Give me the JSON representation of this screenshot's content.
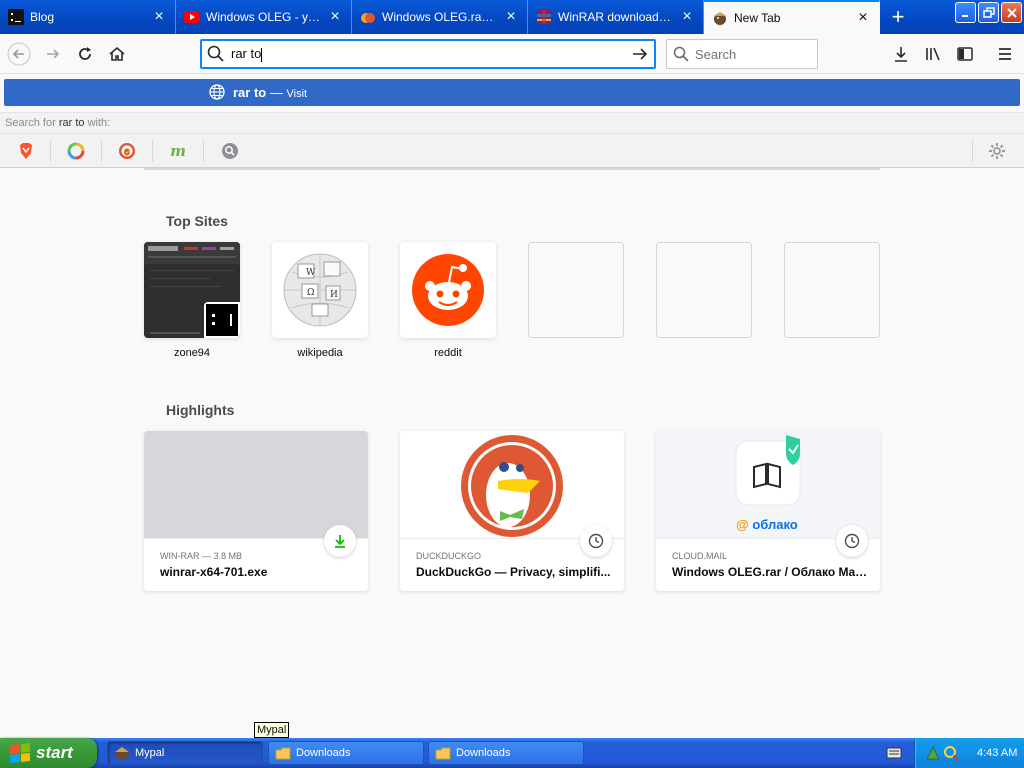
{
  "tabs": [
    {
      "title": "Blog",
      "active": false,
      "favicon": "terminal-favicon"
    },
    {
      "title": "Windows OLEG - устано...",
      "active": false,
      "favicon": "youtube-favicon"
    },
    {
      "title": "Windows OLEG.rar / Об...",
      "active": false,
      "favicon": "cloud-mail-favicon"
    },
    {
      "title": "WinRAR download free ...",
      "active": false,
      "favicon": "winrar-favicon"
    },
    {
      "title": "New Tab",
      "active": true,
      "favicon": "firefox-favicon"
    }
  ],
  "nav": {
    "url_value": "rar to",
    "search_placeholder": "Search"
  },
  "autocomplete": {
    "query": "rar to",
    "separator": "—",
    "action": "Visit",
    "search_for_prefix": "Search for",
    "search_for_term": "rar to",
    "search_for_suffix": "with:",
    "engines": [
      "brave-icon",
      "qwant-icon",
      "duckduckgo-icon",
      "mail-ru-icon",
      "search-engine-icon"
    ]
  },
  "newtab": {
    "top_sites_title": "Top Sites",
    "top_sites": [
      {
        "label": "zone94"
      },
      {
        "label": "wikipedia"
      },
      {
        "label": "reddit"
      },
      {
        "label": ""
      },
      {
        "label": ""
      },
      {
        "label": ""
      }
    ],
    "highlights_title": "Highlights",
    "highlights": [
      {
        "context": "WIN-RAR — 3.8 MB",
        "title": "winrar-x64-701.exe",
        "badge": "download-icon"
      },
      {
        "context": "DUCKDUCKGO",
        "title": "DuckDuckGo — Privacy, simplifi...",
        "badge": "clock-icon"
      },
      {
        "context": "CLOUD.MAIL",
        "title": "Windows OLEG.rar / Облако Mai...",
        "badge": "clock-icon",
        "image_text": "облако"
      }
    ]
  },
  "taskbar": {
    "start_label": "start",
    "tooltip": "Mypal",
    "tasks": [
      {
        "label": "Mypal",
        "active": true
      },
      {
        "label": "Downloads",
        "active": false
      },
      {
        "label": "Downloads",
        "active": false
      }
    ],
    "clock": "4:43 AM"
  },
  "colors": {
    "accent": "#0a84ff",
    "autocomplete_selected": "#3169c6",
    "xp_taskbar": "#245edb",
    "start_green": "#3b9a3b"
  }
}
